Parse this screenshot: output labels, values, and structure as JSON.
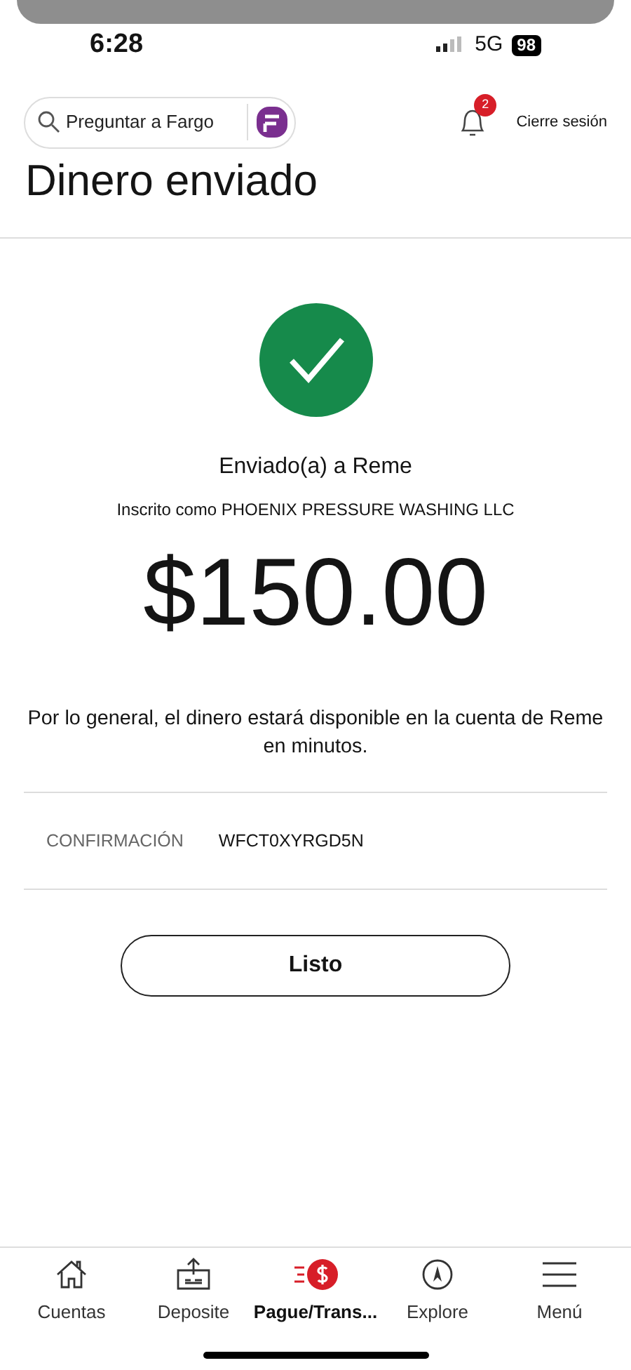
{
  "status_bar": {
    "time": "6:28",
    "network": "5G",
    "battery": "98"
  },
  "header": {
    "search_placeholder": "Preguntar a Fargo",
    "notification_count": "2",
    "logout": "Cierre sesión"
  },
  "title": "Dinero enviado",
  "confirmation": {
    "sent_to": "Enviado(a) a Reme",
    "enrolled_as": "Inscrito como PHOENIX PRESSURE WASHING LLC",
    "amount": "$150.00",
    "note": "Por lo general, el dinero estará disponible en la cuenta de Reme en minutos.",
    "label": "CONFIRMACIÓN",
    "code": "WFCT0XYRGD5N"
  },
  "done_button": "Listo",
  "tabs": [
    {
      "label": "Cuentas",
      "kind": "home",
      "selected": false
    },
    {
      "label": "Deposite",
      "kind": "deposit",
      "selected": false
    },
    {
      "label": "Pague/Trans...",
      "kind": "pay",
      "selected": true
    },
    {
      "label": "Explore",
      "kind": "explore",
      "selected": false
    },
    {
      "label": "Menú",
      "kind": "menu",
      "selected": false
    }
  ]
}
